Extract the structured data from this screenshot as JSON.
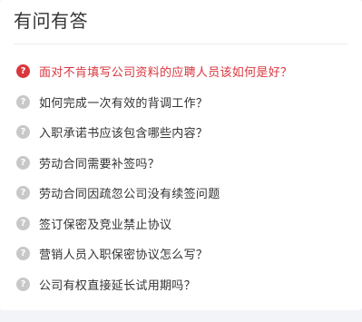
{
  "header": {
    "title": "有问有答"
  },
  "questions": [
    {
      "icon": "?",
      "text": "面对不肯填写公司资料的应聘人员该如何是好？",
      "active": true
    },
    {
      "icon": "?",
      "text": "如何完成一次有效的背调工作？"
    },
    {
      "icon": "?",
      "text": "入职承诺书应该包含哪些内容？"
    },
    {
      "icon": "?",
      "text": "劳动合同需要补签吗？"
    },
    {
      "icon": "?",
      "text": "劳动合同因疏忽公司没有续签问题"
    },
    {
      "icon": "?",
      "text": "签订保密及竞业禁止协议"
    },
    {
      "icon": "?",
      "text": "营销人员入职保密协议怎么写？"
    },
    {
      "icon": "?",
      "text": "公司有权直接延长试用期吗？"
    }
  ],
  "colors": {
    "accent": "#d9363e",
    "icon_default": "#c8c8c8",
    "text": "#333333"
  },
  "icons": {
    "question": "question-circle-icon"
  }
}
